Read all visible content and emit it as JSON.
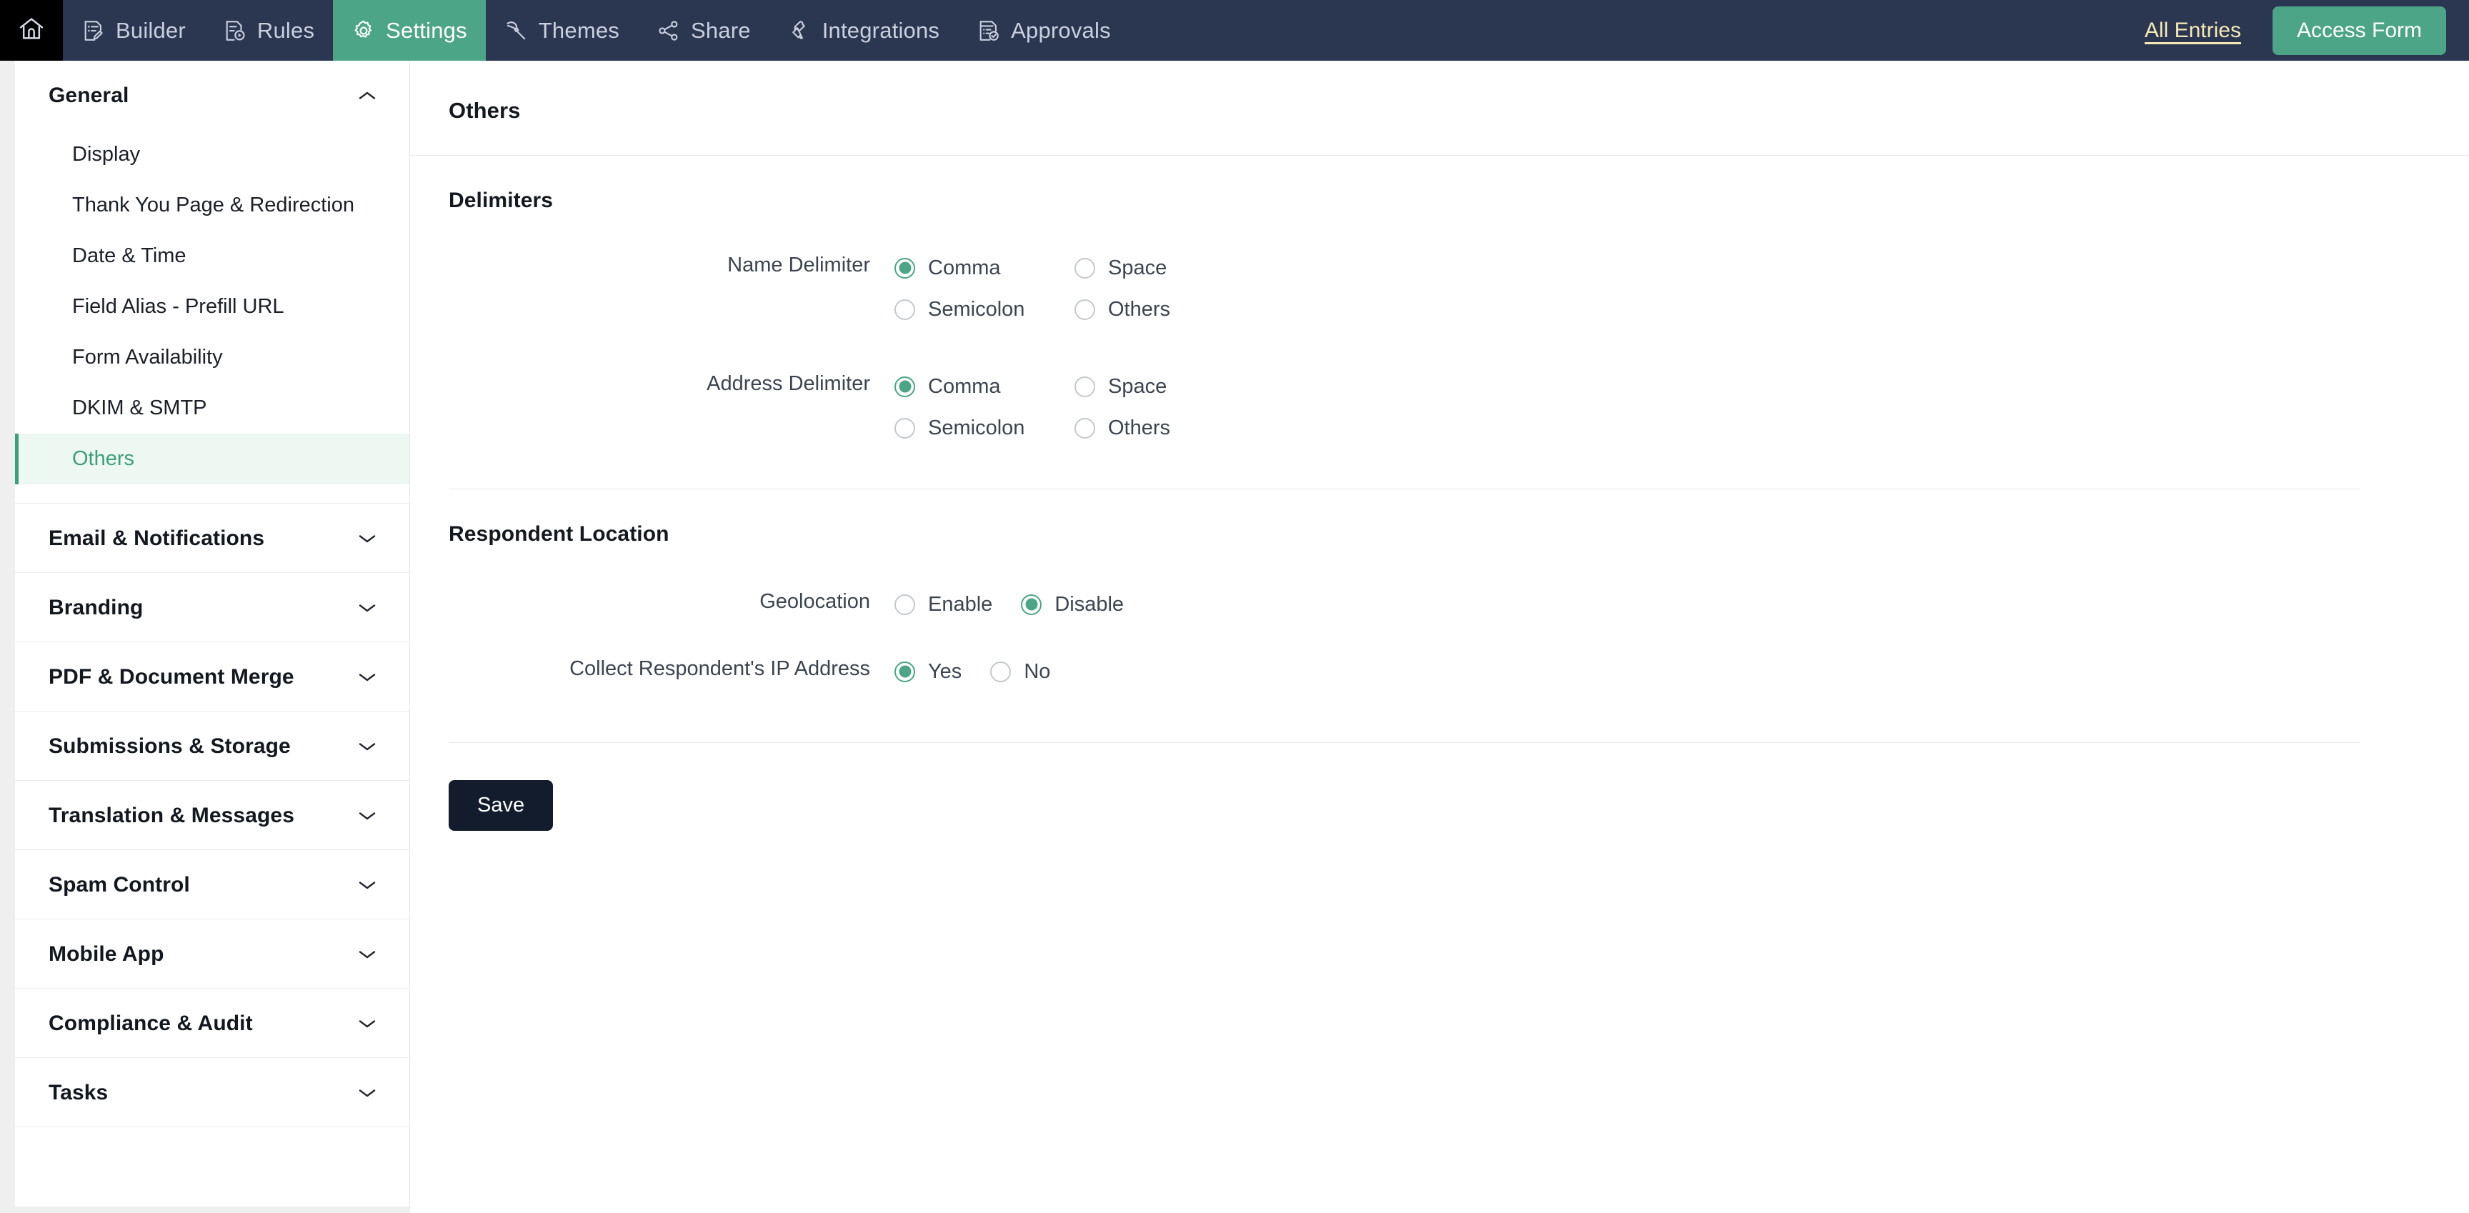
{
  "topnav": {
    "home_icon": "home-icon",
    "tabs": [
      {
        "label": "Builder",
        "icon": "form-builder-icon",
        "active": false
      },
      {
        "label": "Rules",
        "icon": "rules-icon",
        "active": false
      },
      {
        "label": "Settings",
        "icon": "gear-icon",
        "active": true
      },
      {
        "label": "Themes",
        "icon": "paint-roller-icon",
        "active": false
      },
      {
        "label": "Share",
        "icon": "share-nodes-icon",
        "active": false
      },
      {
        "label": "Integrations",
        "icon": "puzzle-piece-icon",
        "active": false
      },
      {
        "label": "Approvals",
        "icon": "approval-check-icon",
        "active": false
      }
    ],
    "all_entries_label": "All Entries",
    "access_form_label": "Access Form",
    "accent_green": "#4ca587",
    "bar_background": "#2b3650",
    "all_entries_color": "#f4e9b6"
  },
  "sidebar": {
    "groups": [
      {
        "title": "General",
        "expanded": true,
        "chevron": "chevron-up-icon",
        "items": [
          {
            "label": "Display",
            "active": false
          },
          {
            "label": "Thank You Page & Redirection",
            "active": false
          },
          {
            "label": "Date & Time",
            "active": false
          },
          {
            "label": "Field Alias - Prefill URL",
            "active": false
          },
          {
            "label": "Form Availability",
            "active": false
          },
          {
            "label": "DKIM & SMTP",
            "active": false
          },
          {
            "label": "Others",
            "active": true
          }
        ]
      },
      {
        "title": "Email & Notifications",
        "expanded": false,
        "chevron": "chevron-down-icon",
        "items": []
      },
      {
        "title": "Branding",
        "expanded": false,
        "chevron": "chevron-down-icon",
        "items": []
      },
      {
        "title": "PDF & Document Merge",
        "expanded": false,
        "chevron": "chevron-down-icon",
        "items": []
      },
      {
        "title": "Submissions & Storage",
        "expanded": false,
        "chevron": "chevron-down-icon",
        "items": []
      },
      {
        "title": "Translation & Messages",
        "expanded": false,
        "chevron": "chevron-down-icon",
        "items": []
      },
      {
        "title": "Spam Control",
        "expanded": false,
        "chevron": "chevron-down-icon",
        "items": []
      },
      {
        "title": "Mobile App",
        "expanded": false,
        "chevron": "chevron-down-icon",
        "items": []
      },
      {
        "title": "Compliance & Audit",
        "expanded": false,
        "chevron": "chevron-down-icon",
        "items": []
      },
      {
        "title": "Tasks",
        "expanded": false,
        "chevron": "chevron-down-icon",
        "items": []
      }
    ],
    "active_item_bg": "#eef8f3",
    "active_item_color": "#3d9e7c"
  },
  "main": {
    "page_title": "Others",
    "sections": [
      {
        "title": "Delimiters",
        "fields": [
          {
            "label": "Name Delimiter",
            "layout": "grid",
            "options": [
              {
                "label": "Comma",
                "selected": true
              },
              {
                "label": "Space",
                "selected": false
              },
              {
                "label": "Semicolon",
                "selected": false
              },
              {
                "label": "Others",
                "selected": false
              }
            ]
          },
          {
            "label": "Address Delimiter",
            "layout": "grid",
            "options": [
              {
                "label": "Comma",
                "selected": true
              },
              {
                "label": "Space",
                "selected": false
              },
              {
                "label": "Semicolon",
                "selected": false
              },
              {
                "label": "Others",
                "selected": false
              }
            ]
          }
        ]
      },
      {
        "title": "Respondent Location",
        "fields": [
          {
            "label": "Geolocation",
            "layout": "inline",
            "options": [
              {
                "label": "Enable",
                "selected": false
              },
              {
                "label": "Disable",
                "selected": true
              }
            ]
          },
          {
            "label": "Collect Respondent's IP Address",
            "layout": "inline",
            "options": [
              {
                "label": "Yes",
                "selected": true
              },
              {
                "label": "No",
                "selected": false
              }
            ]
          }
        ]
      }
    ],
    "save_label": "Save",
    "save_bg": "#121c2d"
  }
}
